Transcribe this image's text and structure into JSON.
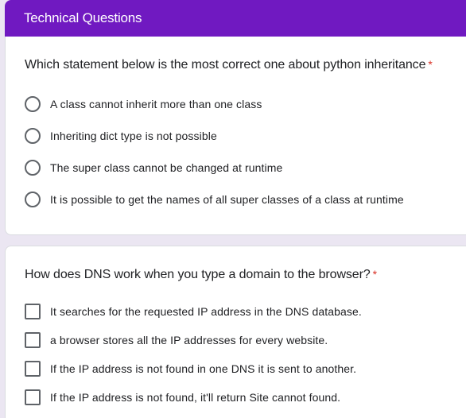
{
  "section": {
    "title": "Technical Questions"
  },
  "question1": {
    "title": "Which statement below is the most correct one about python inheritance",
    "required_mark": "*",
    "type": "radio",
    "options": [
      "A class cannot inherit more than one class",
      "Inheriting dict type is not possible",
      "The super class cannot be changed at runtime",
      "It is possible to get the names of all super classes of a class at runtime"
    ]
  },
  "question2": {
    "title": "How does DNS work when you type a domain to the browser?",
    "required_mark": "*",
    "type": "checkbox",
    "options": [
      "It searches for the requested IP address in the DNS database.",
      "a browser stores all the IP addresses for every website.",
      "If the IP address is not found in one DNS it is sent to another.",
      "If the IP address is not found, it'll return Site cannot found."
    ]
  },
  "colors": {
    "header_bg": "#7019c1",
    "page_bg": "#ebe6f2",
    "required": "#d93025",
    "control_border": "#5f6368"
  }
}
